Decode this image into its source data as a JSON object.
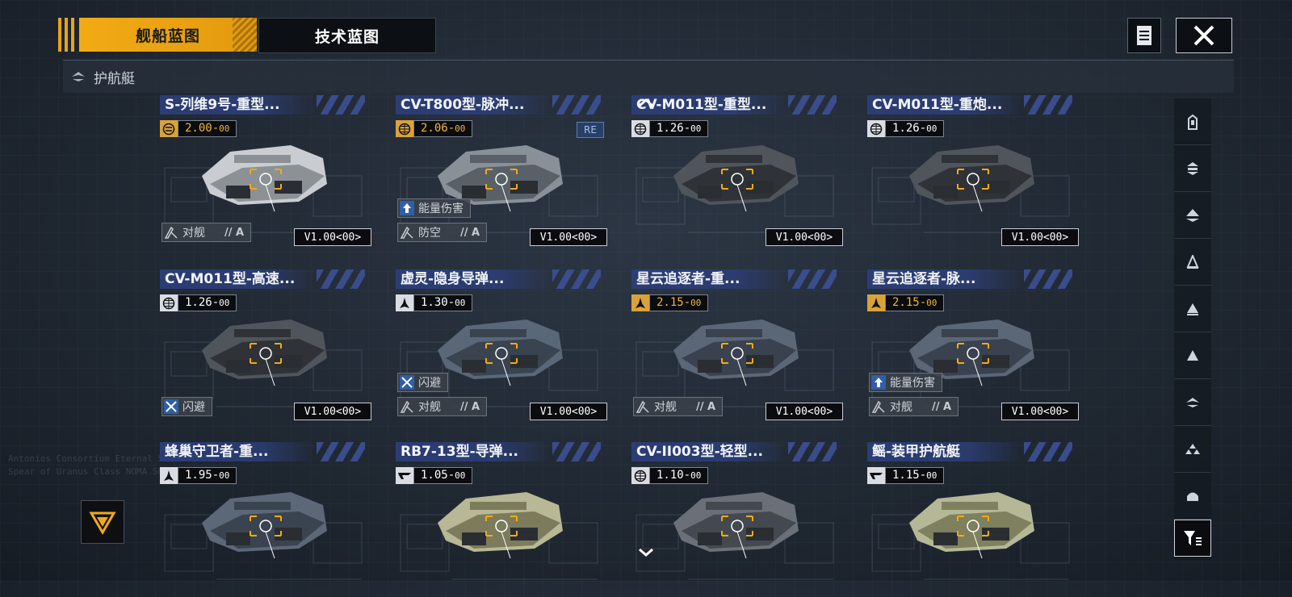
{
  "tabs": [
    {
      "label": "舰船蓝图",
      "active": true
    },
    {
      "label": "技术蓝图",
      "active": false
    }
  ],
  "category": {
    "label": "护航艇"
  },
  "accent_color": "#f2aa14",
  "cards": [
    {
      "title": "S-列维9号-重型...",
      "cost": "2.00",
      "cost_sub": "00",
      "cost_icon": "special-icon",
      "gold": true,
      "tags": [
        {
          "label": "对舰",
          "grade": "A",
          "icon": "anti-ship-icon"
        }
      ],
      "version": "V1.00<00>",
      "re": ""
    },
    {
      "title": "CV-T800型-脉冲...",
      "cost": "2.06",
      "cost_sub": "00",
      "cost_icon": "globe-icon",
      "gold": true,
      "tags": [
        {
          "label": "能量伤害",
          "grade": "",
          "icon": "arrow-up-icon"
        },
        {
          "label": "防空",
          "grade": "A",
          "icon": "anti-ship-icon"
        }
      ],
      "version": "V1.00<00>",
      "re": "RE"
    },
    {
      "title": "CV-M011型-重型...",
      "cost": "1.26",
      "cost_sub": "00",
      "cost_icon": "globe-icon",
      "gold": false,
      "tags": [],
      "version": "V1.00<00>",
      "re": ""
    },
    {
      "title": "CV-M011型-重炮...",
      "cost": "1.26",
      "cost_sub": "00",
      "cost_icon": "globe-icon",
      "gold": false,
      "tags": [],
      "version": "V1.00<00>",
      "re": ""
    },
    {
      "title": "CV-M011型-高速...",
      "cost": "1.26",
      "cost_sub": "00",
      "cost_icon": "globe-icon",
      "gold": false,
      "tags": [
        {
          "label": "闪避",
          "grade": "",
          "icon": "evade-icon"
        }
      ],
      "version": "V1.00<00>",
      "re": ""
    },
    {
      "title": "虚灵-隐身导弹...",
      "cost": "1.30",
      "cost_sub": "00",
      "cost_icon": "rocket-icon",
      "gold": false,
      "tags": [
        {
          "label": "闪避",
          "grade": "",
          "icon": "evade-icon"
        },
        {
          "label": "对舰",
          "grade": "A",
          "icon": "anti-ship-icon"
        }
      ],
      "version": "V1.00<00>",
      "re": ""
    },
    {
      "title": "星云追逐者-重...",
      "cost": "2.15",
      "cost_sub": "00",
      "cost_icon": "rocket-icon",
      "gold": true,
      "tags": [
        {
          "label": "对舰",
          "grade": "A",
          "icon": "anti-ship-icon"
        }
      ],
      "version": "V1.00<00>",
      "re": ""
    },
    {
      "title": "星云追逐者-脉...",
      "cost": "2.15",
      "cost_sub": "00",
      "cost_icon": "rocket-icon",
      "gold": true,
      "tags": [
        {
          "label": "能量伤害",
          "grade": "",
          "icon": "arrow-up-icon"
        },
        {
          "label": "对舰",
          "grade": "A",
          "icon": "anti-ship-icon"
        }
      ],
      "version": "V1.00<00>",
      "re": ""
    },
    {
      "title": "蜂巢守卫者-重...",
      "cost": "1.95",
      "cost_sub": "00",
      "cost_icon": "rocket-icon",
      "gold": false,
      "tags": [],
      "version": "",
      "re": ""
    },
    {
      "title": "RB7-13型-导弹...",
      "cost": "1.05",
      "cost_sub": "00",
      "cost_icon": "wing-icon",
      "gold": false,
      "tags": [],
      "version": "",
      "re": ""
    },
    {
      "title": "CV-II003型-轻型...",
      "cost": "1.10",
      "cost_sub": "00",
      "cost_icon": "globe-icon",
      "gold": false,
      "tags": [],
      "version": "",
      "re": ""
    },
    {
      "title": "鳐-装甲护航艇",
      "cost": "1.15",
      "cost_sub": "00",
      "cost_icon": "wing-icon",
      "gold": false,
      "tags": [],
      "version": "",
      "re": ""
    }
  ],
  "bg_text": [
    "Antonios Consortium Eternal Storm Class",
    "Spear of Uranus Class NOMA Shipping Co"
  ]
}
